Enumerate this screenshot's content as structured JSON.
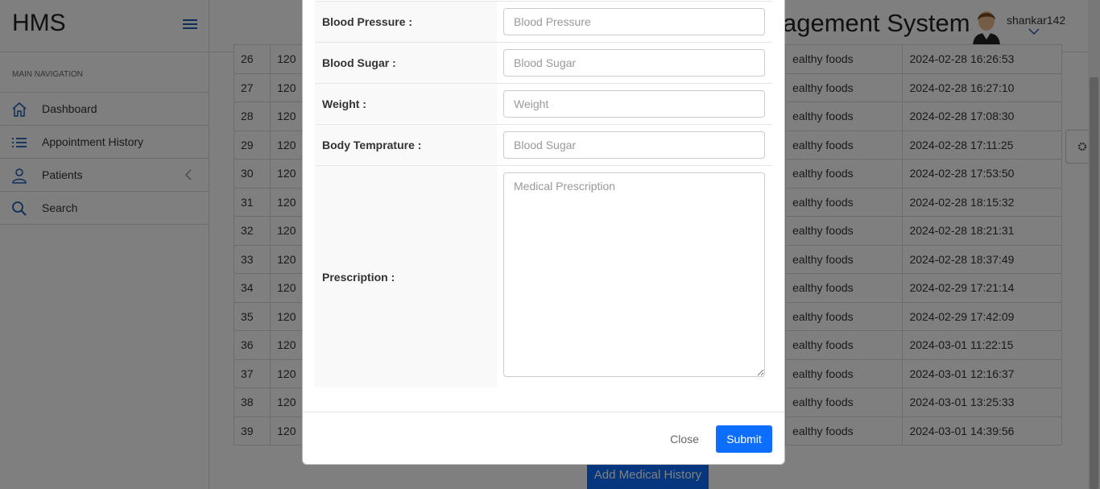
{
  "sidebar": {
    "brand": "HMS",
    "heading": "MAIN NAVIGATION",
    "items": [
      {
        "label": "Dashboard"
      },
      {
        "label": "Appointment History"
      },
      {
        "label": "Patients"
      },
      {
        "label": "Search"
      }
    ]
  },
  "header": {
    "title_visible": "agement System",
    "username": "shankar142"
  },
  "table": {
    "rows": [
      {
        "no": "26",
        "bp": "120",
        "advice": "ealthy foods",
        "date": "2024-02-28 16:26:53"
      },
      {
        "no": "27",
        "bp": "120",
        "advice": "ealthy foods",
        "date": "2024-02-28 16:27:10"
      },
      {
        "no": "28",
        "bp": "120",
        "advice": "ealthy foods",
        "date": "2024-02-28 17:08:30"
      },
      {
        "no": "29",
        "bp": "120",
        "advice": "ealthy foods",
        "date": "2024-02-28 17:11:25"
      },
      {
        "no": "30",
        "bp": "120",
        "advice": "ealthy foods",
        "date": "2024-02-28 17:53:50"
      },
      {
        "no": "31",
        "bp": "120",
        "advice": "ealthy foods",
        "date": "2024-02-28 18:15:32"
      },
      {
        "no": "32",
        "bp": "120",
        "advice": "ealthy foods",
        "date": "2024-02-28 18:21:31"
      },
      {
        "no": "33",
        "bp": "120",
        "advice": "ealthy foods",
        "date": "2024-02-28 18:37:49"
      },
      {
        "no": "34",
        "bp": "120",
        "advice": "ealthy foods",
        "date": "2024-02-29 17:21:14"
      },
      {
        "no": "35",
        "bp": "120",
        "advice": "ealthy foods",
        "date": "2024-02-29 17:42:09"
      },
      {
        "no": "36",
        "bp": "120",
        "advice": "ealthy foods",
        "date": "2024-03-01 11:22:15"
      },
      {
        "no": "37",
        "bp": "120",
        "advice": "ealthy foods",
        "date": "2024-03-01 12:16:37"
      },
      {
        "no": "38",
        "bp": "120",
        "advice": "ealthy foods",
        "date": "2024-03-01 13:25:33"
      },
      {
        "no": "39",
        "bp": "120",
        "advice": "ealthy foods",
        "date": "2024-03-01 14:39:56"
      }
    ]
  },
  "add_button": "Add Medical History",
  "modal": {
    "fields": [
      {
        "label": "Blood Pressure :",
        "placeholder": "Blood Pressure"
      },
      {
        "label": "Blood Sugar :",
        "placeholder": "Blood Sugar"
      },
      {
        "label": "Weight :",
        "placeholder": "Weight"
      },
      {
        "label": "Body Temprature :",
        "placeholder": "Blood Sugar"
      }
    ],
    "prescription_label": "Prescription :",
    "prescription_placeholder": "Medical Prescription",
    "close_label": "Close",
    "submit_label": "Submit"
  },
  "colors": {
    "accent": "#0d6efd",
    "backdrop": "rgba(0,0,0,0.5)"
  }
}
